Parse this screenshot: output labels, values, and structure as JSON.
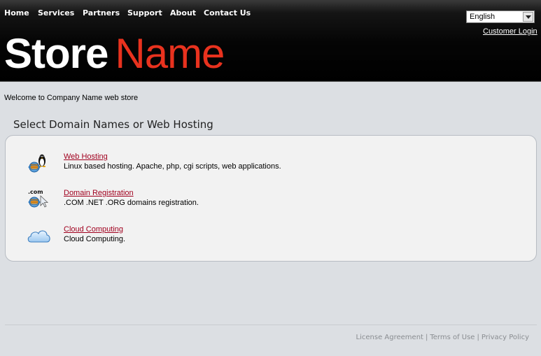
{
  "nav": {
    "items": [
      "Home",
      "Services",
      "Partners",
      "Support",
      "About",
      "Contact Us"
    ]
  },
  "language": {
    "selected": "English"
  },
  "customer_login": "Customer Login",
  "logo": {
    "part1": "Store",
    "part2": "Name"
  },
  "welcome": "Welcome to Company Name web store",
  "section_title": "Select Domain Names or Web Hosting",
  "services": [
    {
      "title": "Web Hosting",
      "description": "Linux based hosting. Apache, php, cgi scripts, web applications.",
      "icon": "linux-hosting-icon"
    },
    {
      "title": "Domain Registration",
      "description": ".COM .NET .ORG domains registration.",
      "icon": "domain-registration-icon",
      "icon_text": ".com"
    },
    {
      "title": "Cloud Computing",
      "description": "Cloud Computing.",
      "icon": "cloud-icon"
    }
  ],
  "footer": {
    "links": [
      "License Agreement",
      "Terms of Use",
      "Privacy Policy"
    ],
    "separator": "|"
  },
  "colors": {
    "header_bg": "#000000",
    "logo_accent": "#e8321e",
    "link": "#a0001e",
    "page_bg": "#dcdfe3",
    "panel_bg": "#f2f2f2"
  }
}
